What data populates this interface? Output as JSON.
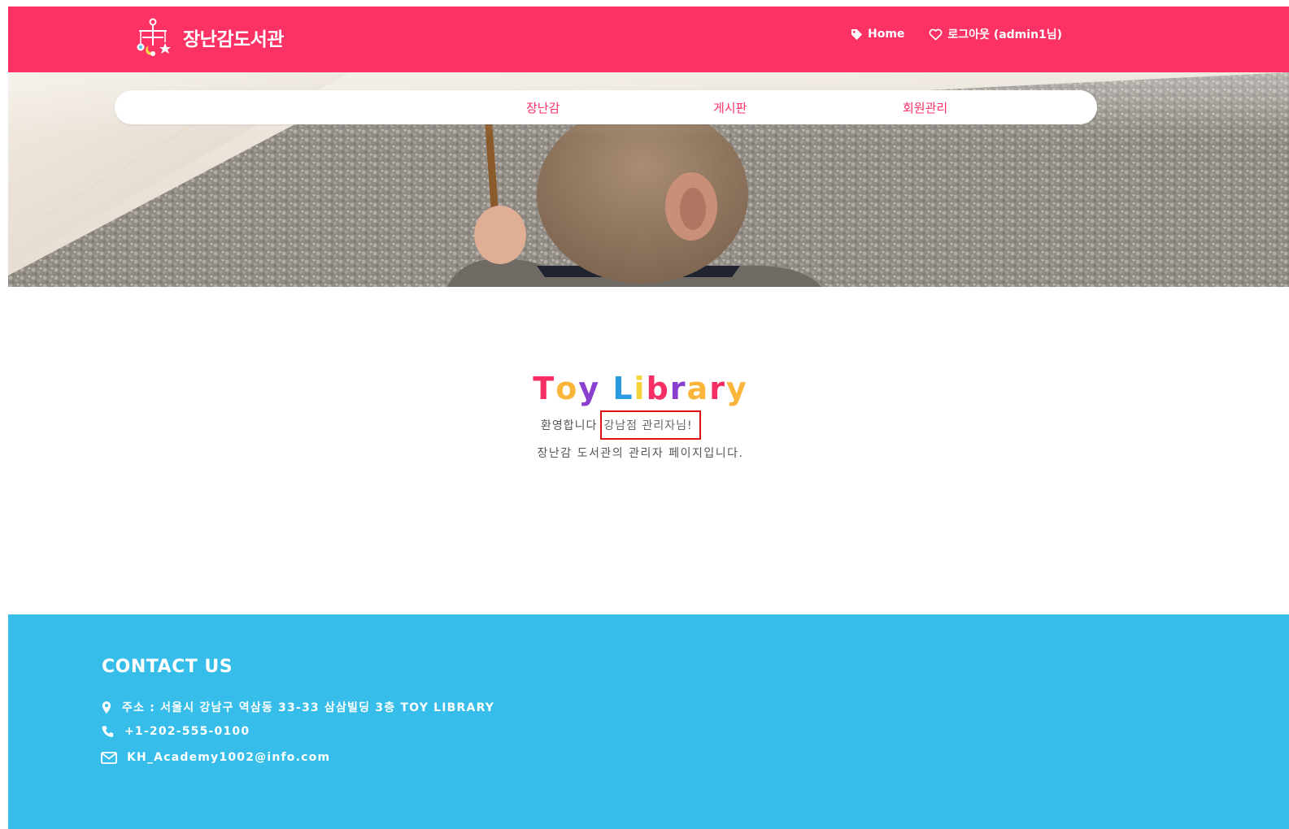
{
  "header": {
    "brand_name": "장난감도서관",
    "brand_icon": "baby-mobile-icon",
    "links": [
      {
        "label": "Home",
        "icon": "tag-icon"
      },
      {
        "label": "로그아웃 (admin1님)",
        "icon": "heart-icon"
      }
    ]
  },
  "nav": {
    "items": [
      {
        "label": "장난감"
      },
      {
        "label": "게시판"
      },
      {
        "label": "회원관리"
      }
    ]
  },
  "main": {
    "logo_letters": [
      "T",
      "o",
      "y",
      " ",
      "L",
      "i",
      "b",
      "r",
      "a",
      "r",
      "y"
    ],
    "logo_colors": [
      "#f52e64",
      "#fbb53b",
      "#8a3fd1",
      "",
      "#2a9be0",
      "#f4d23a",
      "#f52e64",
      "#8a3fd1",
      "#fbb53b",
      "#f52e64",
      "#fbb53b"
    ],
    "welcome_prefix": "환영합니다",
    "welcome_highlight": "강남점 관리자님!",
    "subtitle": "장난감 도서관의 관리자 페이지입니다."
  },
  "footer": {
    "title": "CONTACT US",
    "address": "주소 : 서울시 강남구 역삼동 33-33 삼삼빌딩 3층 TOY LIBRARY",
    "phone": "+1-202-555-0100",
    "email": "KH_Academy1002@info.com",
    "icons": [
      "map-pin-icon",
      "phone-icon",
      "envelope-icon"
    ]
  },
  "colors": {
    "header_bg": "#fc3264",
    "footer_bg": "#37bde9",
    "nav_text": "#fc3264",
    "highlight_border": "#e01010"
  }
}
